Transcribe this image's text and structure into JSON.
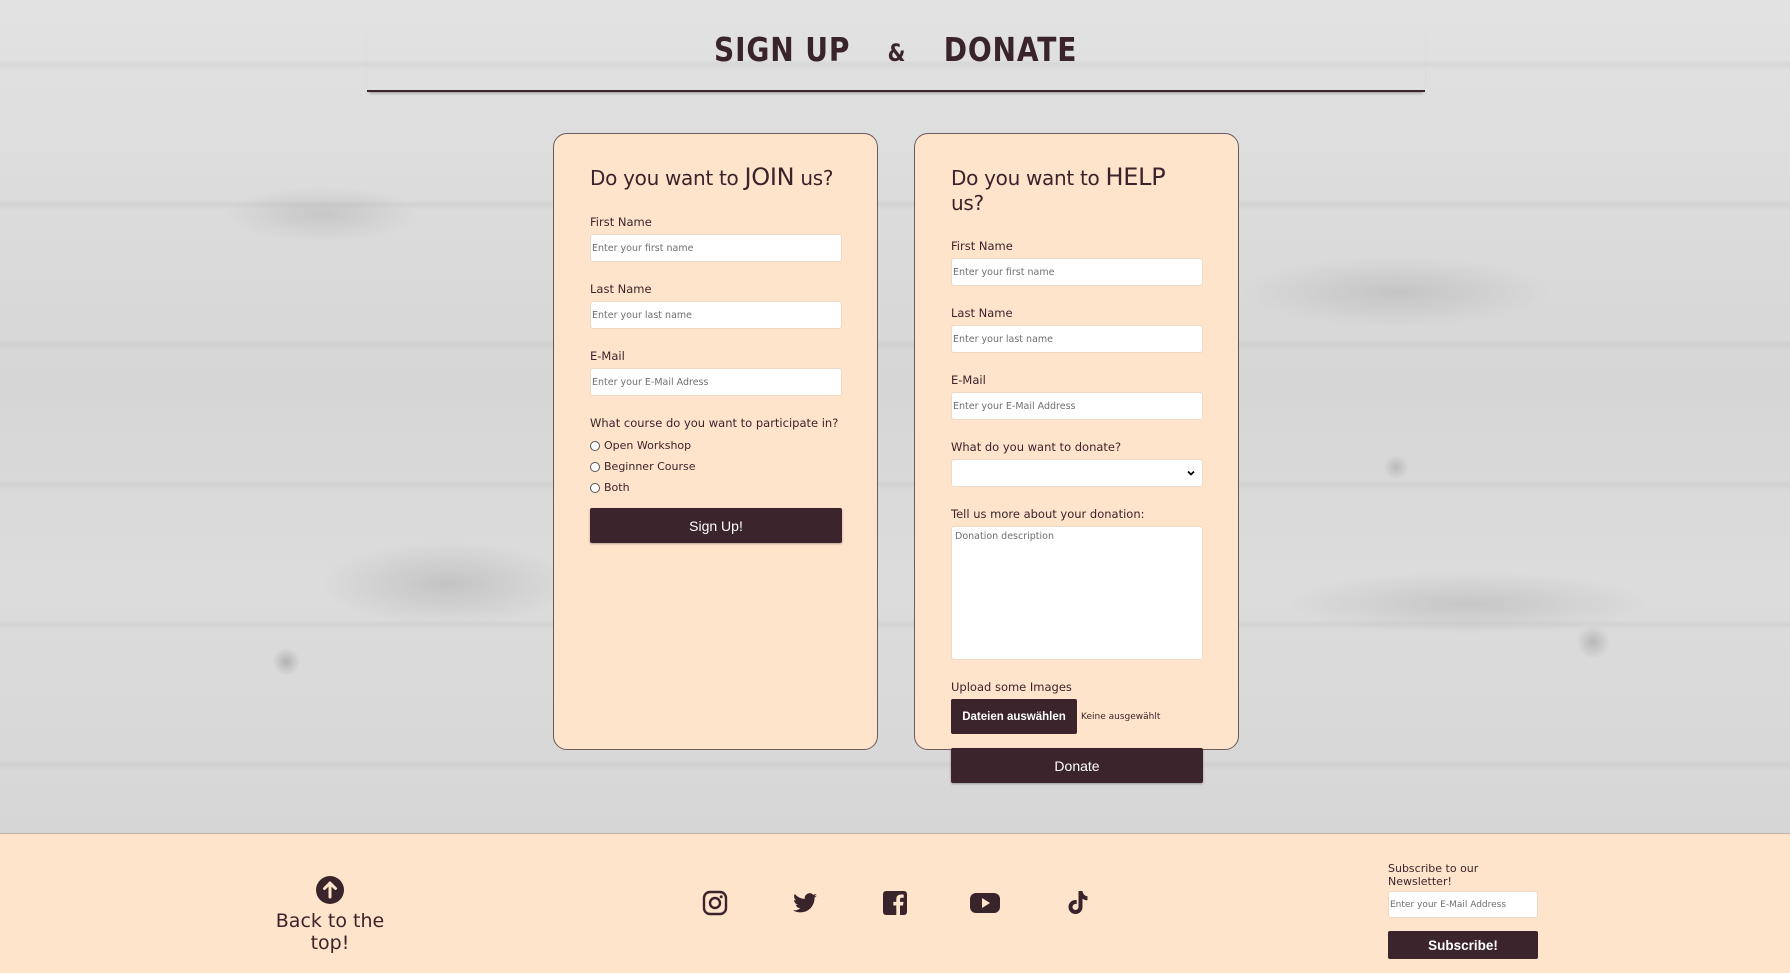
{
  "heading": {
    "part1": "SIGN UP",
    "amp": "&",
    "part2": "DONATE"
  },
  "join_form": {
    "title_pre": "Do you want to ",
    "title_big": "JOIN",
    "title_post": " us?",
    "first_name_label": "First Name",
    "first_name_placeholder": "Enter your first name",
    "last_name_label": "Last Name",
    "last_name_placeholder": "Enter your last name",
    "email_label": "E-Mail",
    "email_placeholder": "Enter your E-Mail Adress",
    "course_question": "What course do you want to participate in?",
    "course_options": [
      "Open Workshop",
      "Beginner Course",
      "Both"
    ],
    "submit_label": "Sign Up!"
  },
  "help_form": {
    "title_pre": "Do you want to ",
    "title_big": "HELP",
    "title_post": " us?",
    "first_name_label": "First Name",
    "first_name_placeholder": "Enter your first name",
    "last_name_label": "Last Name",
    "last_name_placeholder": "Enter your last name",
    "email_label": "E-Mail",
    "email_placeholder": "Enter your E-Mail Address",
    "donate_question": "What do you want to donate?",
    "donate_selected": "",
    "description_label": "Tell us more about your donation:",
    "description_placeholder": "Donation description",
    "upload_label": "Upload some Images",
    "file_button": "Dateien auswählen",
    "file_status": "Keine ausgewählt",
    "submit_label": "Donate"
  },
  "footer": {
    "back_to_top": "Back to the top!",
    "back_icon": "arrow-circle-up-icon",
    "socials": [
      "instagram-icon",
      "twitter-icon",
      "facebook-icon",
      "youtube-icon",
      "tiktok-icon"
    ],
    "newsletter_label": "Subscribe to our Newsletter!",
    "newsletter_placeholder": "Enter your E-Mail Address",
    "newsletter_button": "Subscribe!"
  },
  "colors": {
    "accent": "#3b242b",
    "card_bg": "#ffe4cc",
    "footer_bg": "#ffe4cc"
  }
}
